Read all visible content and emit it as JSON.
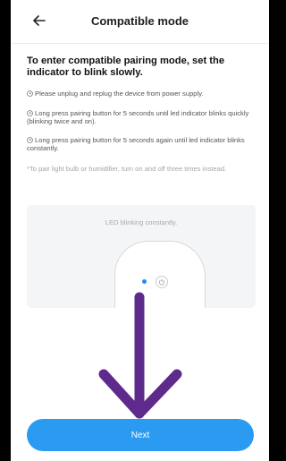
{
  "header": {
    "title": "Compatible mode"
  },
  "instructions": {
    "heading": "To enter compatible pairing mode, set the indicator to blink slowly.",
    "steps": [
      "Please unplug and replug the device from power supply.",
      "Long press pairing button for 5 seconds until led indicator blinks quickly (blinking twice and on).",
      "Long press pairing button for 5 seconds again until led indicator blinks constantly."
    ],
    "note": "*To pair light bulb or humidifier, turn on and off three times instead."
  },
  "illustration": {
    "caption": "LED blinking constantly.",
    "led_color": "#1a8cff"
  },
  "footer": {
    "next_label": "Next"
  },
  "colors": {
    "accent": "#2a9bf0",
    "overlay_arrow": "#5e2a8c"
  }
}
